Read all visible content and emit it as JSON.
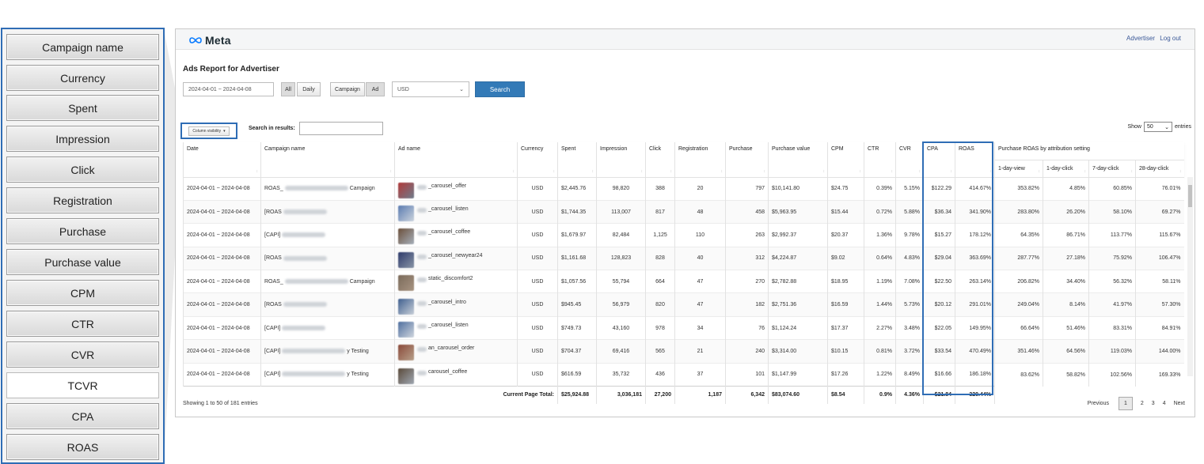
{
  "column_menu": {
    "items": [
      {
        "label": "Campaign name",
        "on": true
      },
      {
        "label": "Currency",
        "on": true
      },
      {
        "label": "Spent",
        "on": true
      },
      {
        "label": "Impression",
        "on": true
      },
      {
        "label": "Click",
        "on": true
      },
      {
        "label": "Registration",
        "on": true
      },
      {
        "label": "Purchase",
        "on": true
      },
      {
        "label": "Purchase value",
        "on": true
      },
      {
        "label": "CPM",
        "on": true
      },
      {
        "label": "CTR",
        "on": true
      },
      {
        "label": "CVR",
        "on": true
      },
      {
        "label": "TCVR",
        "on": false
      },
      {
        "label": "CPA",
        "on": true
      },
      {
        "label": "ROAS",
        "on": true
      }
    ]
  },
  "header": {
    "logo_text": "Meta",
    "advertiser_link": "Advertiser",
    "logout_link": "Log out"
  },
  "report": {
    "title": "Ads Report for Advertiser",
    "date_range": "2024-04-01 ~ 2024-04-08",
    "btn_all": "All",
    "btn_daily": "Daily",
    "btn_campaign": "Campaign",
    "btn_ad": "Ad",
    "currency_select": "USD",
    "search_button": "Search",
    "column_visibility": "Column visibility",
    "search_label": "Search in results:",
    "search_value": "",
    "show_label": "Show",
    "show_value": "50",
    "entries_label": "entries"
  },
  "table": {
    "columns": [
      "Date",
      "Campaign name",
      "Ad name",
      "Currency",
      "Spent",
      "Impression",
      "Click",
      "Registration",
      "Purchase",
      "Purchase value",
      "CPM",
      "CTR",
      "CVR",
      "CPA",
      "ROAS"
    ],
    "roas_group": "Purchase ROAS by attribution setting",
    "roas_sub": [
      "1-day-view",
      "1-day-click",
      "7-day-click",
      "28-day-click"
    ],
    "rows": [
      {
        "date": "2024-04-01 ~ 2024-04-08",
        "campaign": "ROAS_",
        "campaign_tail": "Campaign",
        "ad": "_carousel_offer",
        "currency": "USD",
        "spent": "$2,445.76",
        "impression": "98,820",
        "click": "388",
        "registration": "20",
        "purchase": "797",
        "purchase_value": "$10,141.80",
        "cpm": "$24.75",
        "ctr": "0.39%",
        "cvr": "5.15%",
        "cpa": "$122.29",
        "roas": "414.67%",
        "r1v": "353.82%",
        "r1c": "4.85%",
        "r7c": "60.85%",
        "r28c": "76.01%"
      },
      {
        "date": "2024-04-01 ~ 2024-04-08",
        "campaign": "[ROAS",
        "campaign_tail": "",
        "ad": "_carousel_listen",
        "currency": "USD",
        "spent": "$1,744.35",
        "impression": "113,007",
        "click": "817",
        "registration": "48",
        "purchase": "458",
        "purchase_value": "$5,963.95",
        "cpm": "$15.44",
        "ctr": "0.72%",
        "cvr": "5.88%",
        "cpa": "$36.34",
        "roas": "341.90%",
        "r1v": "283.80%",
        "r1c": "26.20%",
        "r7c": "58.10%",
        "r28c": "69.27%"
      },
      {
        "date": "2024-04-01 ~ 2024-04-08",
        "campaign": "[CAPI]",
        "campaign_tail": "",
        "ad": "_carousel_coffee",
        "currency": "USD",
        "spent": "$1,679.97",
        "impression": "82,484",
        "click": "1,125",
        "registration": "110",
        "purchase": "263",
        "purchase_value": "$2,992.37",
        "cpm": "$20.37",
        "ctr": "1.36%",
        "cvr": "9.78%",
        "cpa": "$15.27",
        "roas": "178.12%",
        "r1v": "64.35%",
        "r1c": "86.71%",
        "r7c": "113.77%",
        "r28c": "115.67%"
      },
      {
        "date": "2024-04-01 ~ 2024-04-08",
        "campaign": "[ROAS",
        "campaign_tail": "",
        "ad": "_carousel_newyear24",
        "currency": "USD",
        "spent": "$1,161.68",
        "impression": "128,823",
        "click": "828",
        "registration": "40",
        "purchase": "312",
        "purchase_value": "$4,224.87",
        "cpm": "$9.02",
        "ctr": "0.64%",
        "cvr": "4.83%",
        "cpa": "$29.04",
        "roas": "363.69%",
        "r1v": "287.77%",
        "r1c": "27.18%",
        "r7c": "75.92%",
        "r28c": "106.47%"
      },
      {
        "date": "2024-04-01 ~ 2024-04-08",
        "campaign": "ROAS_",
        "campaign_tail": "Campaign",
        "ad": "static_discomfort2",
        "currency": "USD",
        "spent": "$1,057.56",
        "impression": "55,794",
        "click": "664",
        "registration": "47",
        "purchase": "270",
        "purchase_value": "$2,782.88",
        "cpm": "$18.95",
        "ctr": "1.19%",
        "cvr": "7.08%",
        "cpa": "$22.50",
        "roas": "263.14%",
        "r1v": "206.82%",
        "r1c": "34.40%",
        "r7c": "56.32%",
        "r28c": "58.11%"
      },
      {
        "date": "2024-04-01 ~ 2024-04-08",
        "campaign": "[ROAS",
        "campaign_tail": "",
        "ad": "_carousel_intro",
        "currency": "USD",
        "spent": "$945.45",
        "impression": "56,979",
        "click": "820",
        "registration": "47",
        "purchase": "182",
        "purchase_value": "$2,751.36",
        "cpm": "$16.59",
        "ctr": "1.44%",
        "cvr": "5.73%",
        "cpa": "$20.12",
        "roas": "291.01%",
        "r1v": "249.04%",
        "r1c": "8.14%",
        "r7c": "41.97%",
        "r28c": "57.30%"
      },
      {
        "date": "2024-04-01 ~ 2024-04-08",
        "campaign": "[CAPI]",
        "campaign_tail": "",
        "ad": "_carousel_listen",
        "currency": "USD",
        "spent": "$749.73",
        "impression": "43,160",
        "click": "978",
        "registration": "34",
        "purchase": "76",
        "purchase_value": "$1,124.24",
        "cpm": "$17.37",
        "ctr": "2.27%",
        "cvr": "3.48%",
        "cpa": "$22.05",
        "roas": "149.95%",
        "r1v": "66.64%",
        "r1c": "51.46%",
        "r7c": "83.31%",
        "r28c": "84.91%"
      },
      {
        "date": "2024-04-01 ~ 2024-04-08",
        "campaign": "[CAPI]",
        "campaign_tail": "y Testing",
        "ad": "an_carousel_order",
        "currency": "USD",
        "spent": "$704.37",
        "impression": "69,416",
        "click": "565",
        "registration": "21",
        "purchase": "240",
        "purchase_value": "$3,314.00",
        "cpm": "$10.15",
        "ctr": "0.81%",
        "cvr": "3.72%",
        "cpa": "$33.54",
        "roas": "470.49%",
        "r1v": "351.46%",
        "r1c": "64.56%",
        "r7c": "119.03%",
        "r28c": "144.00%"
      },
      {
        "date": "2024-04-01 ~ 2024-04-08",
        "campaign": "[CAPI]",
        "campaign_tail": "y Testing",
        "ad": "carousel_coffee",
        "currency": "USD",
        "spent": "$616.59",
        "impression": "35,732",
        "click": "436",
        "registration": "37",
        "purchase": "101",
        "purchase_value": "$1,147.99",
        "cpm": "$17.26",
        "ctr": "1.22%",
        "cvr": "8.49%",
        "cpa": "$16.66",
        "roas": "186.18%",
        "r1v": "83.62%",
        "r1c": "58.82%",
        "r7c": "102.56%",
        "r28c": "169.33%"
      }
    ],
    "totals": {
      "label": "Current Page Total:",
      "spent": "$25,924.88",
      "impression": "3,036,181",
      "click": "27,200",
      "registration": "1,187",
      "purchase": "6,342",
      "purchase_value": "$83,074.60",
      "cpm": "$8.54",
      "ctr": "0.9%",
      "cvr": "4.36%",
      "cpa": "$21.84",
      "roas": "320.44%"
    }
  },
  "footer": {
    "showing": "Showing 1 to 50 of 181 entries",
    "previous": "Previous",
    "pages": [
      "1",
      "2",
      "3",
      "4"
    ],
    "next": "Next"
  },
  "colors": {
    "highlight": "#2f6db5",
    "search_button": "#337ab7"
  }
}
